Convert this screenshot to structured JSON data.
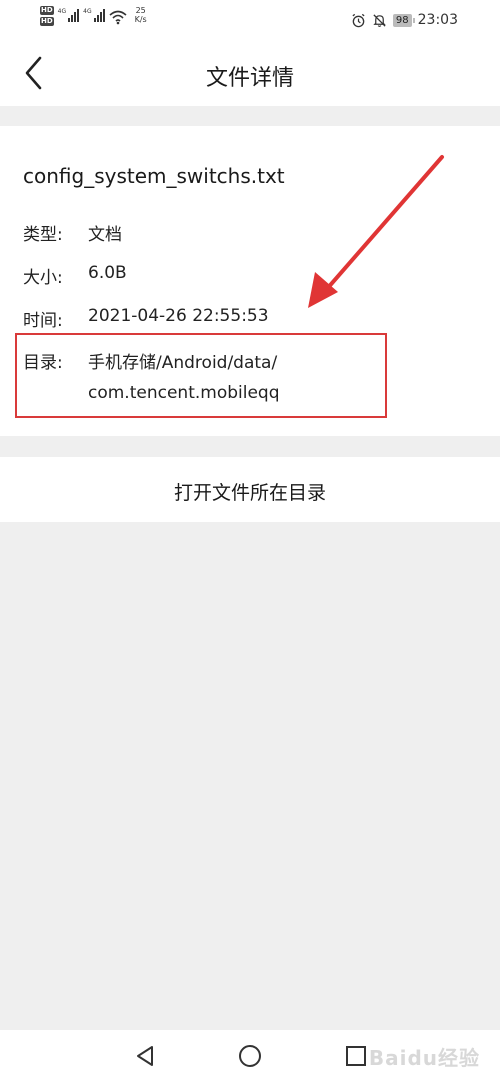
{
  "status_bar": {
    "hd1": "HD",
    "hd2": "HD",
    "net1": "4G",
    "net2": "4G",
    "speed_value": "25",
    "speed_unit": "K/s",
    "battery": "98",
    "time": "23:03"
  },
  "header": {
    "title": "文件详情"
  },
  "file": {
    "name": "config_system_switchs.txt",
    "type_label": "类型:",
    "type_value": "文档",
    "size_label": "大小:",
    "size_value": "6.0B",
    "time_label": "时间:",
    "time_value": "2021-04-26 22:55:53",
    "dir_label": "目录:",
    "dir_value_line1": "手机存储/Android/data/",
    "dir_value_line2": "com.tencent.mobileqq"
  },
  "actions": {
    "open_dir_label": "打开文件所在目录"
  },
  "annotation": {
    "color": "#e03535"
  },
  "watermark": "Baidu经验",
  "icons": [
    "back-arrow-icon",
    "alarm-icon",
    "mute-icon",
    "wifi-icon",
    "nav-back-icon",
    "nav-home-icon",
    "nav-recent-icon"
  ]
}
